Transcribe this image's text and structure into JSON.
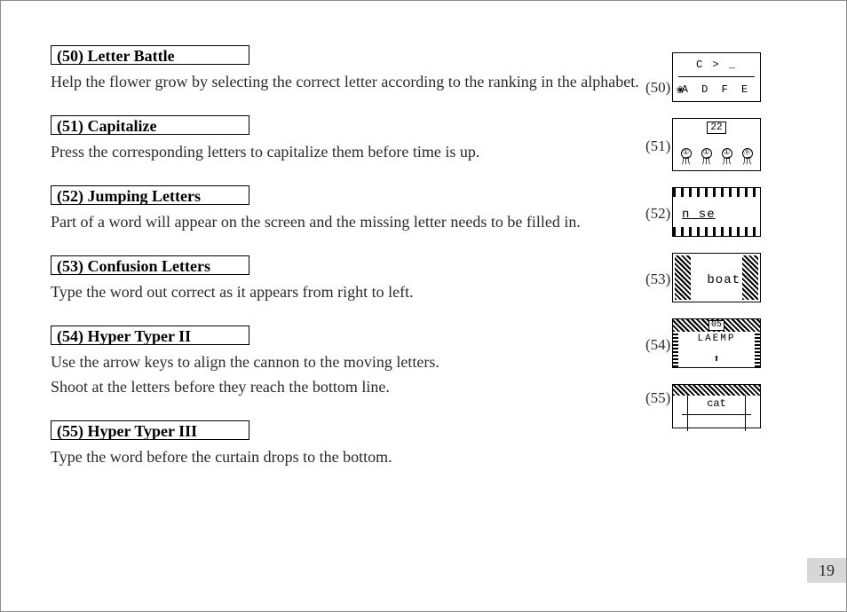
{
  "page_number": "19",
  "sections": [
    {
      "title": "(50) Letter Battle",
      "lines": [
        "Help the flower grow by selecting the correct letter according to the ranking in the alphabet."
      ]
    },
    {
      "title": "(51) Capitalize",
      "lines": [
        "Press the corresponding letters to capitalize them before time is up."
      ]
    },
    {
      "title": "(52) Jumping Letters",
      "lines": [
        "Part of a word will appear on the screen and the missing letter needs to be filled in."
      ]
    },
    {
      "title": "(53) Confusion Letters",
      "lines": [
        "Type the word out correct as it appears from right to left."
      ]
    },
    {
      "title": "(54) Hyper Typer II",
      "lines": [
        "Use the arrow keys to align the cannon to the moving letters.",
        "Shoot at the letters before they reach the bottom line."
      ]
    },
    {
      "title": "(55) Hyper Typer III",
      "lines": [
        "Type the word before the curtain drops to the bottom."
      ]
    }
  ],
  "thumbnails": {
    "50": {
      "label": "(50)",
      "top": "C > _",
      "bottom": "A D F E"
    },
    "51": {
      "label": "(51)",
      "top_number": "22",
      "bugs": [
        "①",
        "①",
        "①",
        "⓪"
      ]
    },
    "52": {
      "label": "(52)",
      "word": "n_se"
    },
    "53": {
      "label": "(53)",
      "word": "boat"
    },
    "54": {
      "label": "(54)",
      "top_number": "05",
      "letters": "LAEMP",
      "cannon": "⬆"
    },
    "55": {
      "label": "(55)",
      "word": "cat"
    }
  }
}
